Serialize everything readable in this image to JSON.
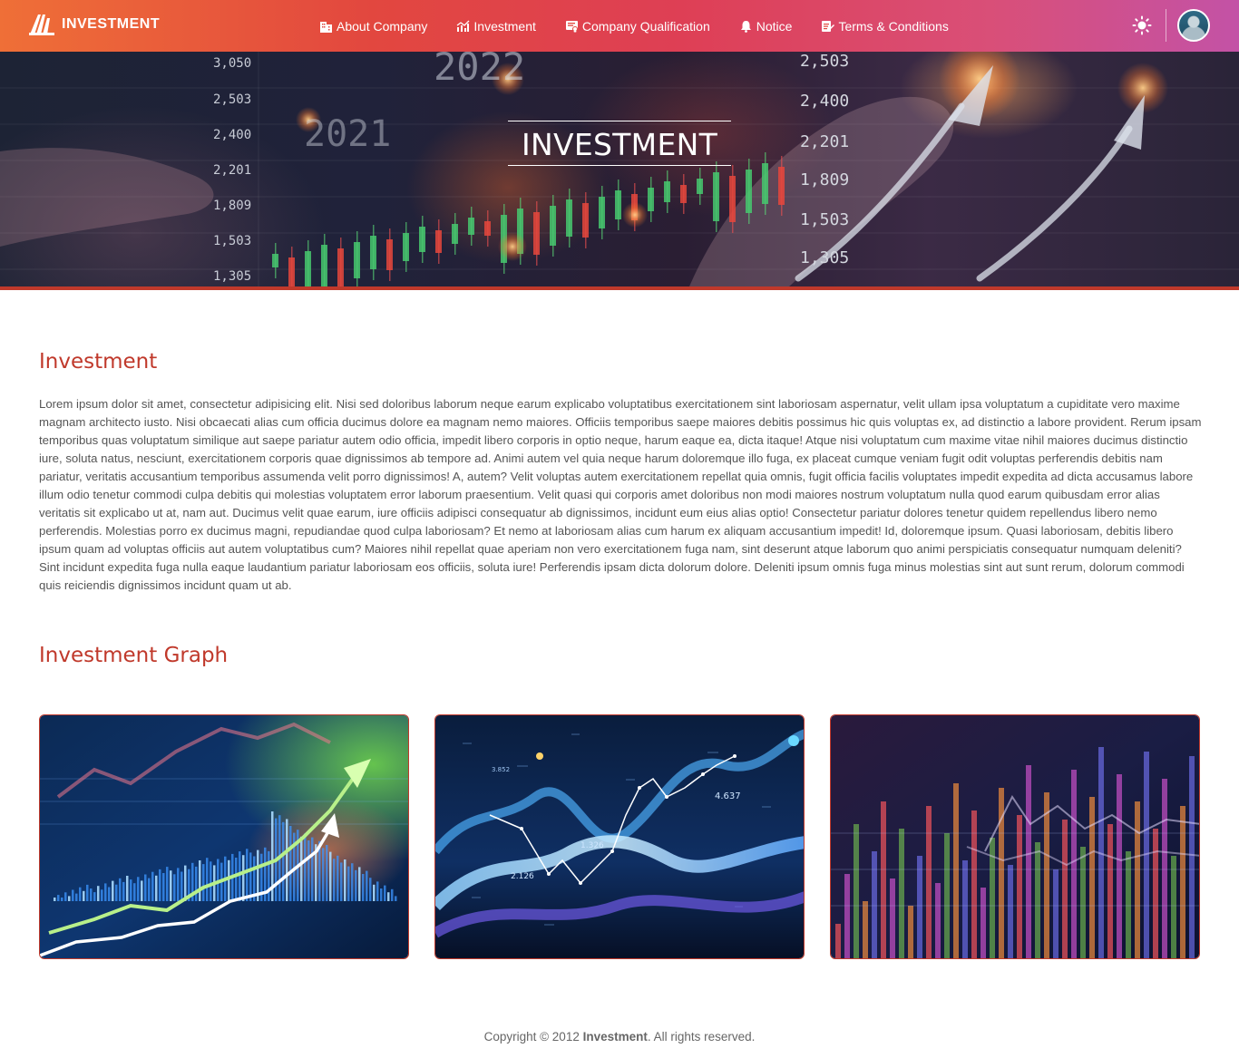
{
  "navbar": {
    "brand": "INVESTMENT",
    "items": [
      {
        "label": "About Company",
        "icon": "building-icon"
      },
      {
        "label": "Investment",
        "icon": "chart-icon"
      },
      {
        "label": "Company Qualification",
        "icon": "certificate-icon"
      },
      {
        "label": "Notice",
        "icon": "bell-icon"
      },
      {
        "label": "Terms & Conditions",
        "icon": "edit-document-icon"
      }
    ],
    "theme_toggle_icon": "sun-icon",
    "avatar_icon": "user-avatar"
  },
  "hero": {
    "title": "INVESTMENT",
    "price_labels_left": [
      "3,050",
      "2,503",
      "2,400",
      "2,201",
      "1,809",
      "1,503",
      "1,305"
    ],
    "price_labels_right": [
      "2,503",
      "2,400",
      "2,201",
      "1,809",
      "1,503",
      "1,305"
    ],
    "years": [
      "2022",
      "2021"
    ]
  },
  "main": {
    "section_title": "Investment",
    "paragraph": "Lorem ipsum dolor sit amet, consectetur adipisicing elit. Nisi sed doloribus laborum neque earum explicabo voluptatibus exercitationem sint laboriosam aspernatur, velit ullam ipsa voluptatum a cupiditate vero maxime magnam architecto iusto. Nisi obcaecati alias cum officia ducimus dolore ea magnam nemo maiores. Officiis temporibus saepe maiores debitis possimus hic quis voluptas ex, ad distinctio a labore provident. Rerum ipsam temporibus quas voluptatum similique aut saepe pariatur autem odio officia, impedit libero corporis in optio neque, harum eaque ea, dicta itaque! Atque nisi voluptatum cum maxime vitae nihil maiores ducimus distinctio iure, soluta natus, nesciunt, exercitationem corporis quae dignissimos ab tempore ad. Animi autem vel quia neque harum doloremque illo fuga, ex placeat cumque veniam fugit odit voluptas perferendis debitis nam pariatur, veritatis accusantium temporibus assumenda velit porro dignissimos! A, autem? Velit voluptas autem exercitationem repellat quia omnis, fugit officia facilis voluptates impedit expedita ad dicta accusamus labore illum odio tenetur commodi culpa debitis qui molestias voluptatem error laborum praesentium. Velit quasi qui corporis amet doloribus non modi maiores nostrum voluptatum nulla quod earum quibusdam error alias veritatis sit explicabo ut at, nam aut. Ducimus velit quae earum, iure officiis adipisci consequatur ab dignissimos, incidunt eum eius alias optio! Consectetur pariatur dolores tenetur quidem repellendus libero nemo perferendis. Molestias porro ex ducimus magni, repudiandae quod culpa laboriosam? Et nemo at laboriosam alias cum harum ex aliquam accusantium impedit! Id, doloremque ipsum. Quasi laboriosam, debitis libero ipsum quam ad voluptas officiis aut autem voluptatibus cum? Maiores nihil repellat quae aperiam non vero exercitationem fuga nam, sint deserunt atque laborum quo animi perspiciatis consequatur numquam deleniti? Sint incidunt expedita fuga nulla eaque laudantium pariatur laboriosam eos officiis, soluta iure! Perferendis ipsam dicta dolorum dolore. Deleniti ipsum omnis fuga minus molestias sint aut sunt rerum, dolorum commodi quis reiciendis dignissimos incidunt quam ut ab.",
    "graph_title": "Investment Graph",
    "graph_labels": [
      "4.637",
      "3.852",
      "2.126",
      "1.326"
    ]
  },
  "footer": {
    "prefix": "Copyright © 2012 ",
    "brand": "Investment",
    "suffix": ". All rights reserved."
  },
  "colors": {
    "accent": "#c0392b",
    "nav_gradient": [
      "#ef6f37",
      "#de3f55",
      "#c352a6"
    ]
  }
}
